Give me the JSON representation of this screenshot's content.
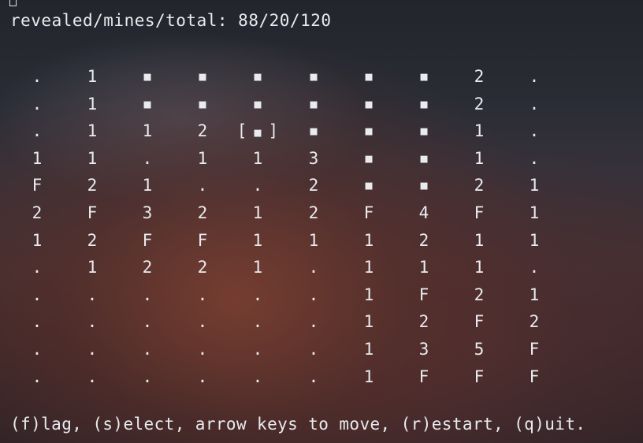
{
  "status": {
    "label": "revealed/mines/total:",
    "revealed": "88",
    "mines": "20",
    "total": "120"
  },
  "board": {
    "cursor_cell": {
      "row": 2,
      "col": 4
    },
    "cursor_brackets": [
      "[",
      "]"
    ],
    "rows": [
      [
        ".",
        "1",
        "■",
        "■",
        "■",
        "■",
        "■",
        "■",
        "2",
        "."
      ],
      [
        ".",
        "1",
        "■",
        "■",
        "■",
        "■",
        "■",
        "■",
        "2",
        "."
      ],
      [
        ".",
        "1",
        "1",
        "2",
        "■",
        "■",
        "■",
        "■",
        "1",
        "."
      ],
      [
        "1",
        "1",
        ".",
        "1",
        "1",
        "3",
        "■",
        "■",
        "1",
        "."
      ],
      [
        "F",
        "2",
        "1",
        ".",
        ".",
        "2",
        "■",
        "■",
        "2",
        "1"
      ],
      [
        "2",
        "F",
        "3",
        "2",
        "1",
        "2",
        "F",
        "4",
        "F",
        "1"
      ],
      [
        "1",
        "2",
        "F",
        "F",
        "1",
        "1",
        "1",
        "2",
        "1",
        "1"
      ],
      [
        ".",
        "1",
        "2",
        "2",
        "1",
        ".",
        "1",
        "1",
        "1",
        "."
      ],
      [
        ".",
        ".",
        ".",
        ".",
        ".",
        ".",
        "1",
        "F",
        "2",
        "1"
      ],
      [
        ".",
        ".",
        ".",
        ".",
        ".",
        ".",
        "1",
        "2",
        "F",
        "2"
      ],
      [
        ".",
        ".",
        ".",
        ".",
        ".",
        ".",
        "1",
        "3",
        "5",
        "F"
      ],
      [
        ".",
        ".",
        ".",
        ".",
        ".",
        ".",
        "1",
        "F",
        "F",
        "F"
      ]
    ]
  },
  "help": {
    "text": "(f)lag, (s)elect, arrow keys to move, (r)estart, (q)uit."
  }
}
